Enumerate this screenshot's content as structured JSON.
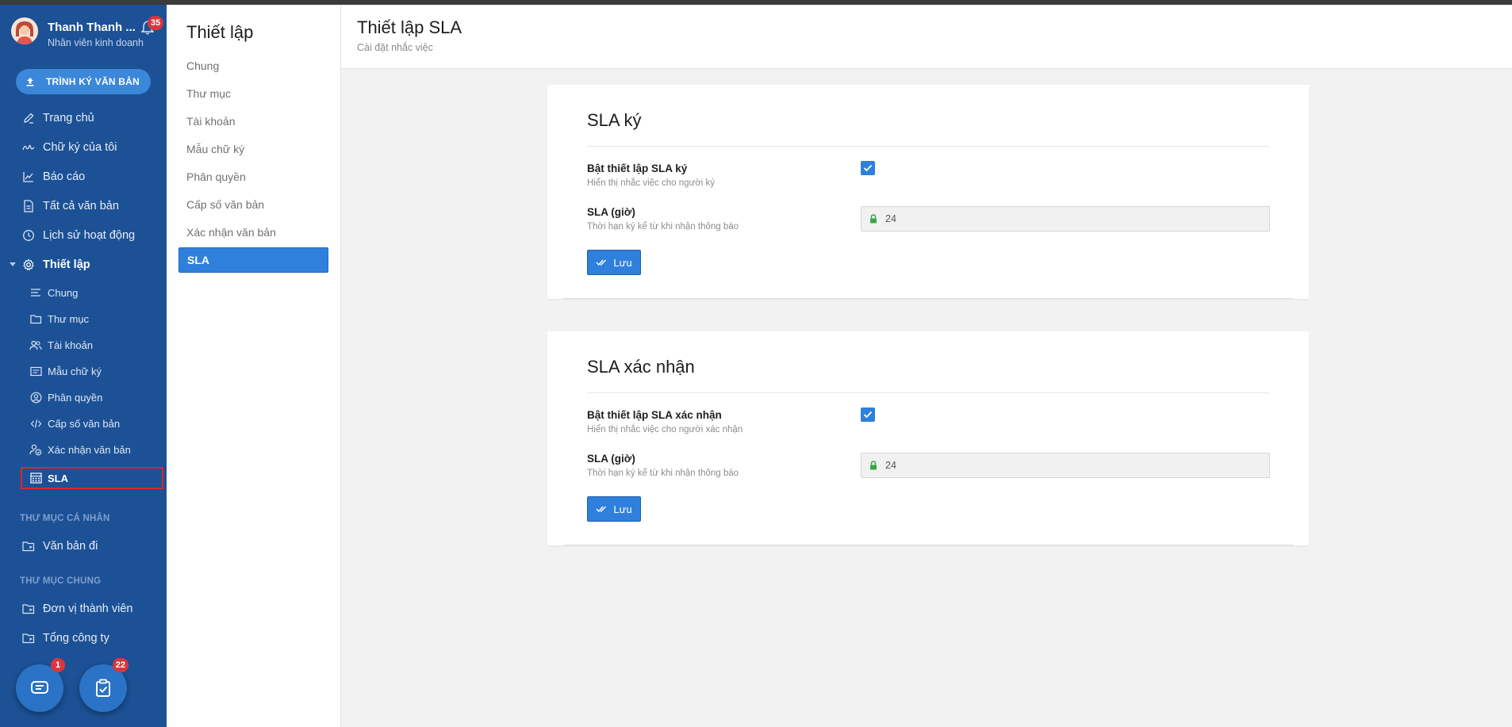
{
  "user": {
    "name": "Thanh Thanh ...",
    "role": "Nhân viên kinh doanh",
    "notifications": "35"
  },
  "sidebar": {
    "sign_button": "TRÌNH KÝ VĂN BẢN",
    "nav": [
      {
        "label": "Trang chủ",
        "icon": "pen-icon"
      },
      {
        "label": "Chữ ký của tôi",
        "icon": "signature-icon"
      },
      {
        "label": "Báo cáo",
        "icon": "chart-icon"
      },
      {
        "label": "Tất cả văn bản",
        "icon": "document-icon"
      },
      {
        "label": "Lịch sử hoạt động",
        "icon": "clock-icon"
      },
      {
        "label": "Thiết lập",
        "icon": "gear-icon"
      }
    ],
    "sub": [
      {
        "label": "Chung",
        "icon": "list-icon"
      },
      {
        "label": "Thư mục",
        "icon": "folder-icon"
      },
      {
        "label": "Tài khoản",
        "icon": "users-icon"
      },
      {
        "label": "Mẫu chữ ký",
        "icon": "template-icon"
      },
      {
        "label": "Phân quyền",
        "icon": "user-circle-icon"
      },
      {
        "label": "Cấp số văn bản",
        "icon": "code-icon"
      },
      {
        "label": "Xác nhận văn bản",
        "icon": "user-check-icon"
      },
      {
        "label": "SLA",
        "icon": "calendar-grid-icon"
      }
    ],
    "personal_section": "THƯ MỤC CÁ NHÂN",
    "personal_items": [
      {
        "label": "Văn bản đi",
        "icon": "folder-icon"
      }
    ],
    "shared_section": "THƯ MỤC CHUNG",
    "shared_items": [
      {
        "label": "Đơn vị thành viên",
        "icon": "folder-icon"
      },
      {
        "label": "Tổng công ty",
        "icon": "folder-icon"
      }
    ],
    "chat_badge": "1",
    "task_badge": "22"
  },
  "submenu": {
    "title": "Thiết lập",
    "items": [
      "Chung",
      "Thư mục",
      "Tài khoản",
      "Mẫu chữ ký",
      "Phân quyền",
      "Cấp số văn bản",
      "Xác nhận văn bản",
      "SLA"
    ],
    "active": "SLA"
  },
  "header": {
    "title": "Thiết lập SLA",
    "subtitle": "Cài đặt nhắc việc"
  },
  "cards": [
    {
      "title": "SLA ký",
      "toggle_label": "Bật thiết lập SLA ký",
      "toggle_help": "Hiển thị nhắc việc cho người ký",
      "toggle_checked": true,
      "hours_label": "SLA (giờ)",
      "hours_help": "Thời hạn ký kể từ khi nhận thông báo",
      "hours_value": "24",
      "save_label": "Lưu"
    },
    {
      "title": "SLA xác nhận",
      "toggle_label": "Bật thiết lập SLA xác nhận",
      "toggle_help": "Hiển thị nhắc việc cho người xác nhận",
      "toggle_checked": true,
      "hours_label": "SLA (giờ)",
      "hours_help": "Thời hạn ký kể từ khi nhận thông báo",
      "hours_value": "24",
      "save_label": "Lưu"
    }
  ],
  "colors": {
    "sidebar": "#1c5196",
    "accent": "#2f80dd",
    "badge": "#d9363e",
    "lock": "#3aa548"
  }
}
